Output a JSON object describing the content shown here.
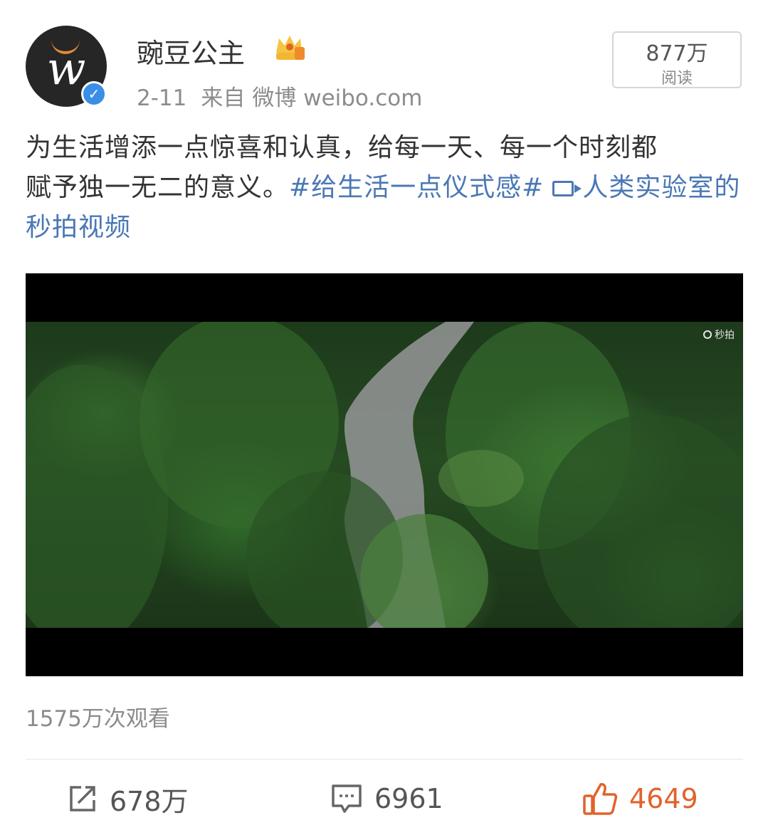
{
  "post": {
    "username": "豌豆公主",
    "verified_icon": "verified-badge-icon",
    "crown_icon": "crown-vip-icon",
    "date": "2-11",
    "source_prefix": "来自",
    "source": "微博 weibo.com",
    "read_count": "877万",
    "read_label": "阅读",
    "text_line1": "为生活增添一点惊喜和认真，给每一天、每一个时刻都",
    "text_line2": "赋予独一无二的意义。",
    "hashtag": "#给生活一点仪式感#",
    "video_link": "人类实验室的秒拍视频"
  },
  "video": {
    "watermark": "秒拍",
    "view_count": "1575万次观看"
  },
  "actions": {
    "repost_count": "678万",
    "comment_count": "6961",
    "like_count": "4649"
  },
  "colors": {
    "link": "#4a78b5",
    "like": "#e2622b",
    "secondary_text": "#8c8c8c"
  }
}
